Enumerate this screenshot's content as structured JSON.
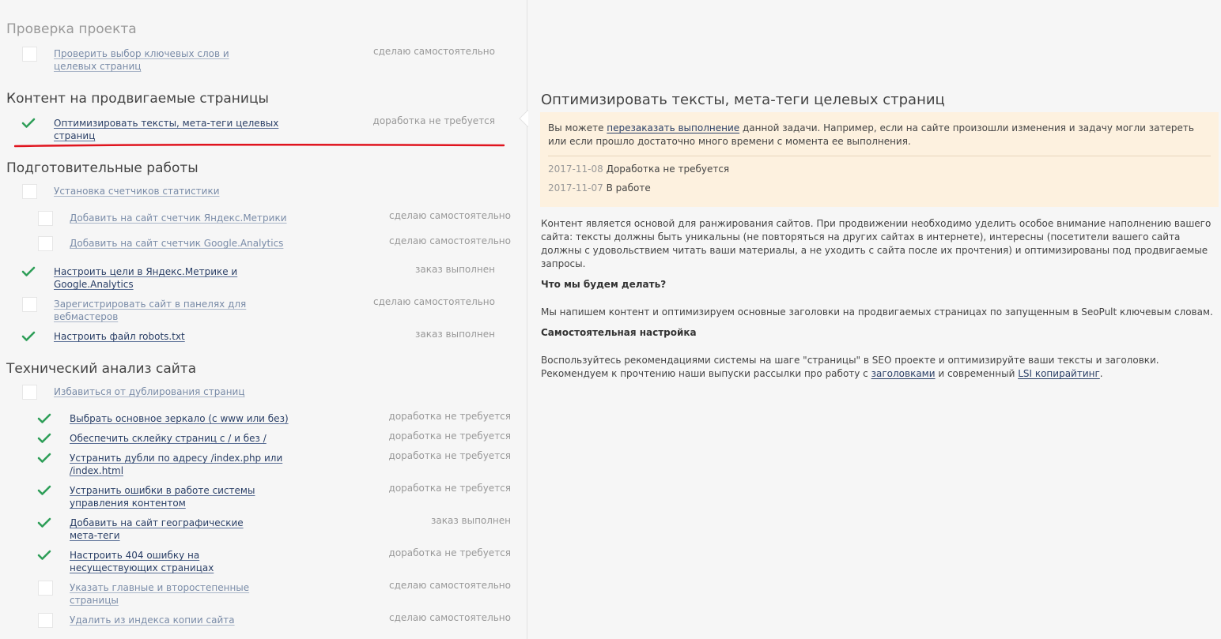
{
  "sections": [
    {
      "title": "Проверка проекта",
      "muted": true
    },
    {
      "title": "Контент на продвигаемые страницы",
      "muted": false
    },
    {
      "title": "Подготовительные работы",
      "muted": false
    },
    {
      "title": "Технический анализ сайта",
      "muted": false
    }
  ],
  "tasks": [
    {
      "label": "Проверить выбор ключевых слов и целевых страниц",
      "status": "сделаю самостоятельно",
      "done": false
    },
    {
      "label": "Оптимизировать тексты, мета-теги целевых страниц",
      "status": "доработка не требуется",
      "done": true
    },
    {
      "label": "Установка счетчиков статистики",
      "status": "",
      "done": false
    },
    {
      "label": "Добавить на сайт счетчик Яндекс.Метрики",
      "status": "сделаю самостоятельно",
      "done": false
    },
    {
      "label": "Добавить на сайт счетчик Google.Analytics",
      "status": "сделаю самостоятельно",
      "done": false
    },
    {
      "label": "Настроить цели в Яндекс.Метрике и Google.Analytics",
      "status": "заказ выполнен",
      "done": true
    },
    {
      "label": "Зарегистрировать сайт в панелях для вебмастеров",
      "status": "сделаю самостоятельно",
      "done": false
    },
    {
      "label": "Настроить файл robots.txt",
      "status": "заказ выполнен",
      "done": true
    },
    {
      "label": "Избавиться от дублирования страниц",
      "status": "",
      "done": false
    },
    {
      "label": "Выбрать основное зеркало (с www или без)",
      "status": "доработка не требуется",
      "done": true
    },
    {
      "label": "Обеспечить склейку страниц с / и без /",
      "status": "доработка не требуется",
      "done": true
    },
    {
      "label": "Устранить дубли по адресу /index.php или /index.html",
      "status": "доработка не требуется",
      "done": true
    },
    {
      "label": "Устранить ошибки в работе системы управления контентом",
      "status": "доработка не требуется",
      "done": true
    },
    {
      "label": "Добавить на сайт географические мета-теги",
      "status": "заказ выполнен",
      "done": true
    },
    {
      "label": "Настроить 404 ошибку на несуществующих страницах",
      "status": "доработка не требуется",
      "done": true
    },
    {
      "label": "Указать главные и второстепенные страницы",
      "status": "сделаю самостоятельно",
      "done": false
    },
    {
      "label": "Удалить из индекса копии сайта",
      "status": "сделаю самостоятельно",
      "done": false
    }
  ],
  "detail": {
    "title": "Оптимизировать тексты, мета-теги целевых страниц",
    "notice_pre": "Вы можете ",
    "notice_link": "перезаказать выполнение",
    "notice_post": "  данной задачи. Например, если на сайте произошли изменения и задачу могли затереть или если прошло достаточно много времени с момента ее выполнения.",
    "history": [
      {
        "date": "2017-11-08",
        "text": "Доработка не требуется"
      },
      {
        "date": "2017-11-07",
        "text": "В работе"
      }
    ],
    "intro": "Контент является основой для ранжирования сайтов. При продвижении необходимо уделить особое внимание наполнению вашего сайта: тексты должны быть уникальны (не повторяться на других сайтах в интернете), интересны (посетители вашего сайта должны с удовольствием читать ваши материалы, а не уходить с сайта после их прочтения) и оптимизированы под продвигаемые запросы.",
    "h1": "Что мы будем делать?",
    "p1": "Мы напишем контент и оптимизируем основные заголовки на продвигаемых страницах по запущенным в SeoPult ключевым словам.",
    "h2": "Самостоятельная настройка",
    "p2_pre": "Воспользуйтесь рекомендациями системы на шаге \"страницы\" в SEO проекте и оптимизируйте ваши тексты и заголовки. Рекомендуем к прочтению наши выпуски рассылки про работу с ",
    "p2_link1": "заголовками",
    "p2_mid": " и современный ",
    "p2_link2": "LSI копирайтинг",
    "p2_post": "."
  },
  "colors": {
    "check": "#2e9e58",
    "underline_marker": "#e0141e",
    "notice_bg": "#fdf1df"
  }
}
